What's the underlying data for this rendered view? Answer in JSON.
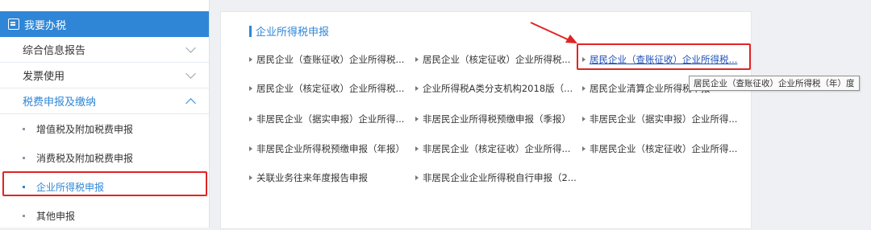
{
  "sidebar": {
    "header": "我要办税",
    "items": [
      {
        "label": "综合信息报告"
      },
      {
        "label": "发票使用"
      },
      {
        "label": "税费申报及缴纳"
      }
    ],
    "subitems": [
      {
        "label": "增值税及附加税费申报"
      },
      {
        "label": "消费税及附加税费申报"
      },
      {
        "label": "企业所得税申报"
      },
      {
        "label": "其他申报"
      }
    ]
  },
  "panel": {
    "title": "企业所得税申报",
    "links": [
      "居民企业（查账征收）企业所得税...",
      "居民企业（核定征收）企业所得税...",
      "居民企业（查账征收）企业所得税...",
      "居民企业（核定征收）企业所得税...",
      "企业所得税A类分支机构2018版（...",
      "居民企业清算企业所得税申报",
      "非居民企业（据实申报）企业所得...",
      "非居民企业所得税预缴申报（季报）",
      "非居民企业（据实申报）企业所得...",
      "非居民企业所得税预缴申报（年报）",
      "非居民企业（核定征收）企业所得...",
      "非居民企业（核定征收）企业所得...",
      "关联业务往来年度报告申报",
      "非居民企业企业所得税自行申报（2..."
    ]
  },
  "tooltip": "居民企业（查账征收）企业所得税（年）度",
  "colors": {
    "accent": "#2f86d6",
    "highlight": "#e02424",
    "link_selected": "#1d4fb8"
  }
}
